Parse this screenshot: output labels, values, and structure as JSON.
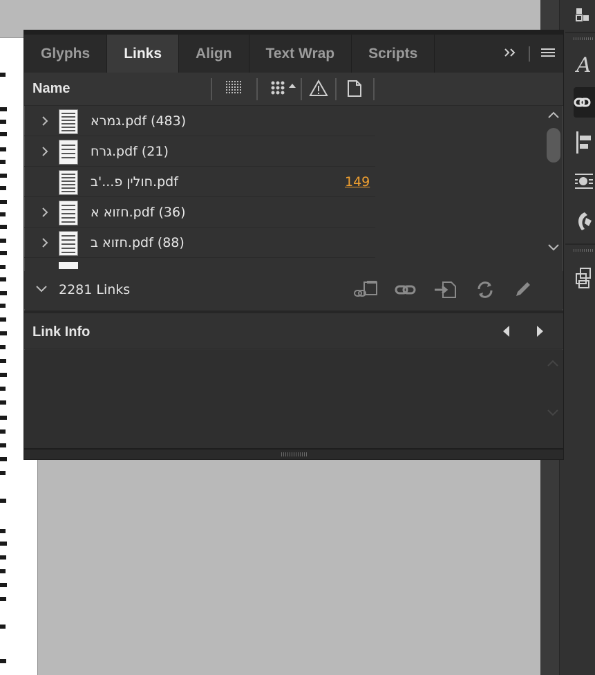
{
  "panel": {
    "tabs": [
      {
        "label": "Glyphs",
        "active": false
      },
      {
        "label": "Links",
        "active": true
      },
      {
        "label": "Align",
        "active": false
      },
      {
        "label": "Text Wrap",
        "active": false
      },
      {
        "label": "Scripts",
        "active": false
      }
    ],
    "column_header": {
      "name_label": "Name",
      "icons": [
        "filter-grid-icon",
        "sort-grid-icon",
        "sort-ascending-icon",
        "warning-icon",
        "page-icon"
      ]
    },
    "rows": [
      {
        "label": "גמרא.pdf (483)",
        "page": "",
        "expandable": true
      },
      {
        "label": "גרח.pdf (21)",
        "page": "",
        "expandable": true
      },
      {
        "label": "חולין פ...'ב.pdf",
        "page": "149",
        "expandable": false
      },
      {
        "label": "חזוא א.pdf (36)",
        "page": "",
        "expandable": true
      },
      {
        "label": "חזוא ב.pdf (88)",
        "page": "",
        "expandable": true
      }
    ],
    "links_summary": {
      "count_label": "2281 Links",
      "actions": [
        "relink-from-folder-icon",
        "relink-icon",
        "go-to-link-icon",
        "update-link-icon",
        "edit-original-icon"
      ]
    },
    "link_info": {
      "title": "Link Info"
    }
  },
  "dock": {
    "icons": [
      "panel-icon",
      "character-styles-icon",
      "links-icon",
      "align-icon",
      "text-wrap-icon",
      "scripts-icon",
      "pages-icon"
    ],
    "active": "links-icon"
  },
  "colors": {
    "panel_bg": "#323232",
    "tab_bar_bg": "#2a2a2a",
    "active_tab_bg": "#3a3a3a",
    "page_link": "#f0a030",
    "canvas_bg": "#b9b9b9"
  }
}
